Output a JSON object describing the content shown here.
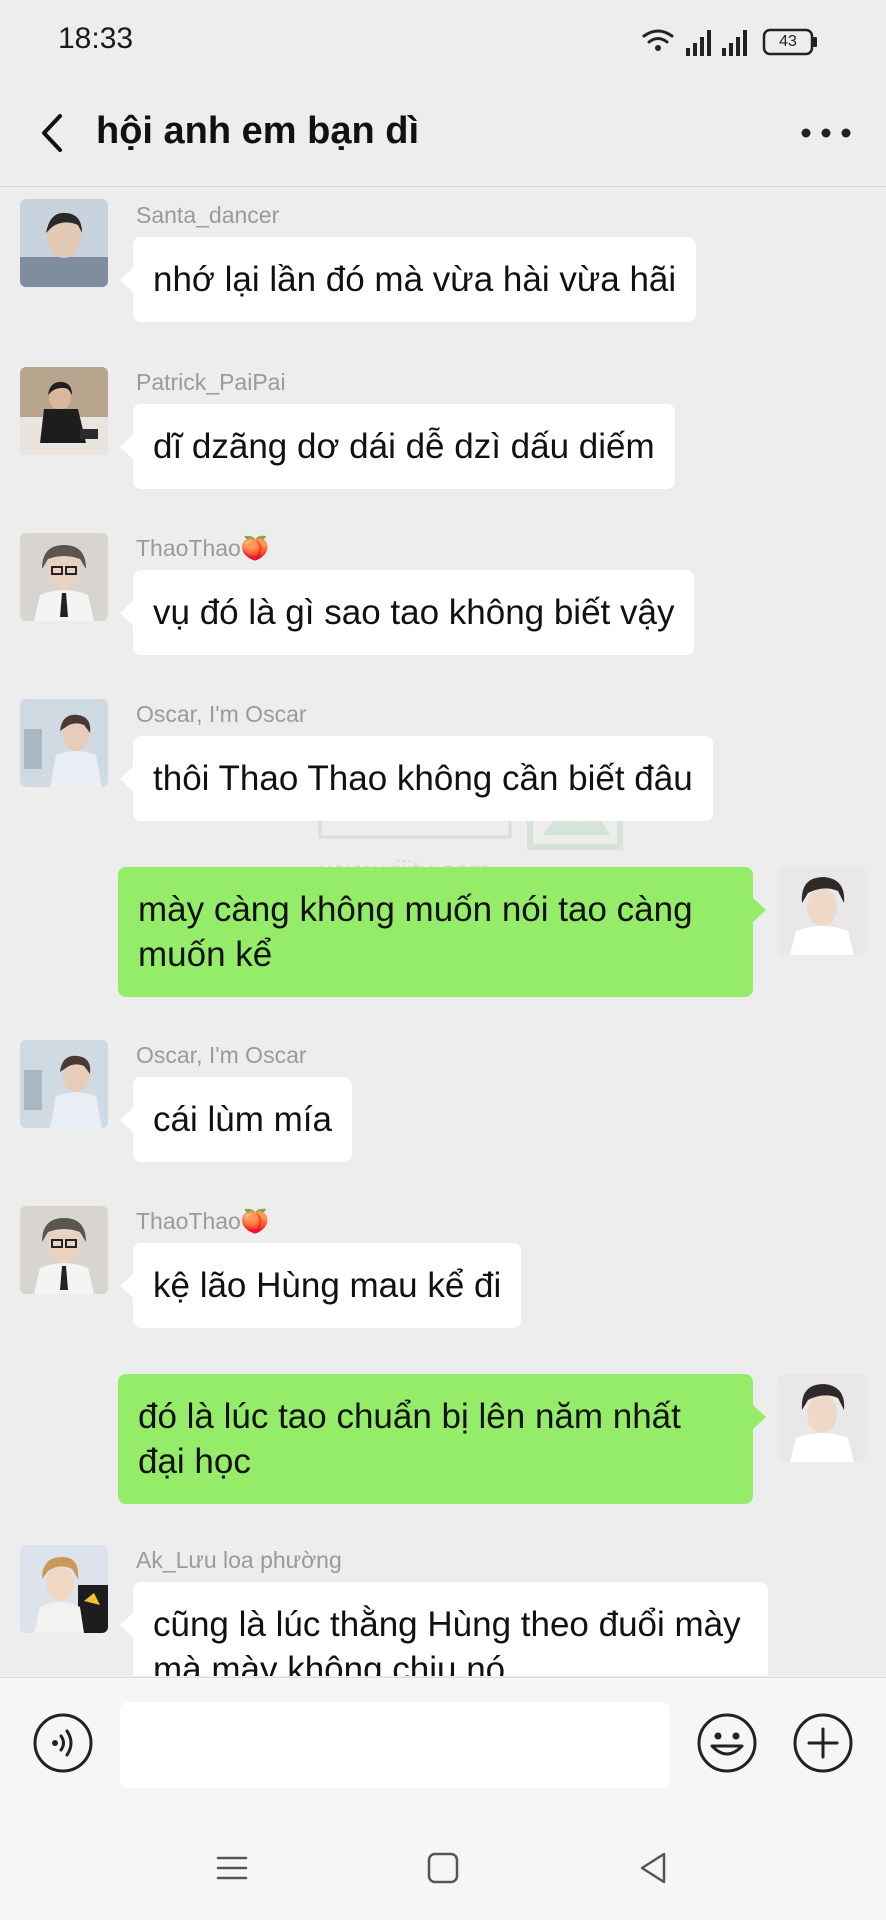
{
  "status_bar": {
    "time": "18:33",
    "battery": "43"
  },
  "header": {
    "title": "hội anh em bạn dì"
  },
  "watermark": {
    "text": "www.yijitu.com"
  },
  "messages": [
    {
      "sender": "Santa_dancer",
      "text": "nhớ lại lần đó mà vừa hài vừa hãi",
      "from_me": false
    },
    {
      "sender": "Patrick_PaiPai",
      "text": "dĩ dzãng dơ dái dễ dzì dấu diếm",
      "from_me": false
    },
    {
      "sender": "ThaoThao🍑",
      "text": "vụ đó là gì sao tao không biết vậy",
      "from_me": false
    },
    {
      "sender": "Oscar, I'm Oscar",
      "text": "thôi Thao Thao không cần biết đâu",
      "from_me": false
    },
    {
      "sender": "",
      "text": "mày càng không muốn nói tao càng muốn kể",
      "from_me": true
    },
    {
      "sender": "Oscar, I'm Oscar",
      "text": "cái lùm mía",
      "from_me": false
    },
    {
      "sender": "ThaoThao🍑",
      "text": "kệ lão Hùng mau kể đi",
      "from_me": false
    },
    {
      "sender": "",
      "text": "đó là lúc tao chuẩn bị lên năm nhất đại học",
      "from_me": true
    },
    {
      "sender": "Ak_Lưu loa phường",
      "text": "cũng là lúc thằng Hùng theo đuổi mày mà mày không chịu nó",
      "from_me": false
    }
  ],
  "input": {
    "value": "",
    "placeholder": ""
  },
  "colors": {
    "background": "#ededed",
    "incoming_bubble": "#ffffff",
    "outgoing_bubble": "#95ec69"
  }
}
